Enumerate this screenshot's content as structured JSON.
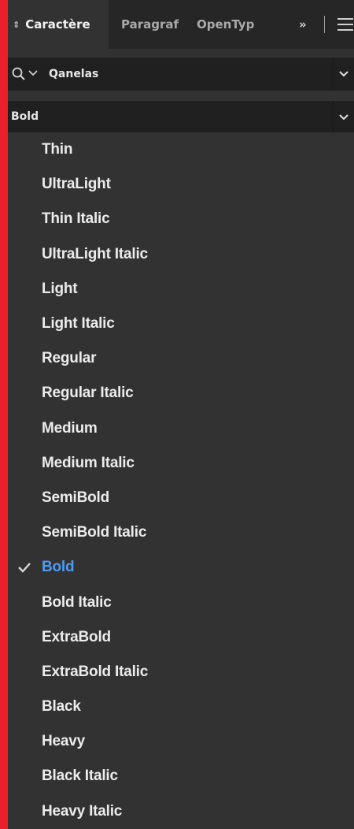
{
  "tabs": [
    {
      "label": "Caractère",
      "active": true
    },
    {
      "label": "Paragraf",
      "active": false
    },
    {
      "label": "OpenTyp",
      "active": false
    }
  ],
  "tab_overflow": "»",
  "panel_menu_icon": "hamburger-menu-icon",
  "font_family": {
    "value": "Qanelas",
    "search_icon": "search-icon",
    "dropdown_icon": "chevron-down-icon"
  },
  "font_style": {
    "value": "Bold",
    "dropdown_icon": "chevron-down-icon"
  },
  "style_options": [
    "Thin",
    "UltraLight",
    "Thin Italic",
    "UltraLight Italic",
    "Light",
    "Light Italic",
    "Regular",
    "Regular Italic",
    "Medium",
    "Medium Italic",
    "SemiBold",
    "SemiBold Italic",
    "Bold",
    "Bold Italic",
    "ExtraBold",
    "ExtraBold Italic",
    "Black",
    "Heavy",
    "Black Italic",
    "Heavy Italic"
  ],
  "selected_option": "Bold",
  "colors": {
    "frame_border": "#e8202a",
    "panel_bg": "#323232",
    "field_bg": "#202020",
    "selected_text": "#4d9bf0"
  }
}
